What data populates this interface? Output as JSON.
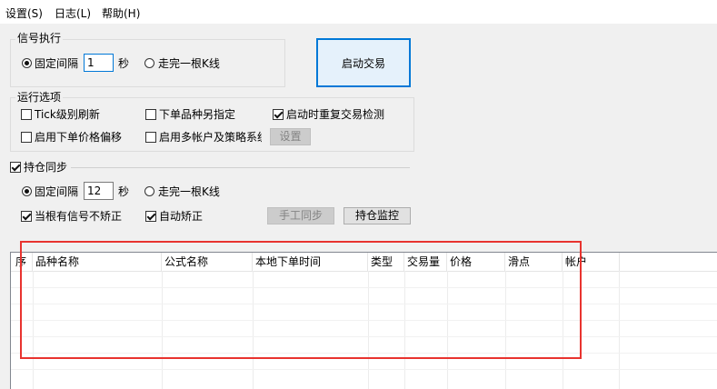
{
  "menu": {
    "items": [
      "设置(S)",
      "日志(L)",
      "帮助(H)"
    ]
  },
  "signal": {
    "title": "信号执行",
    "fixed_interval_label": "固定间隔",
    "interval_value": "1",
    "seconds_label": "秒",
    "kline_label": "走完一根K线",
    "selected": "固定间隔"
  },
  "start_button": "启动交易",
  "run_options": {
    "title": "运行选项",
    "tick_refresh": {
      "label": "Tick级别刷新",
      "checked": false
    },
    "order_variety": {
      "label": "下单品种另指定",
      "checked": false
    },
    "restart_check": {
      "label": "启动时重复交易检测",
      "checked": true
    },
    "price_offset": {
      "label": "启用下单价格偏移",
      "checked": false
    },
    "multi_account": {
      "label": "启用多帐户及策略系统",
      "checked": false
    },
    "settings_button": "设置"
  },
  "position_sync": {
    "title": "持仓同步",
    "checked": true,
    "fixed_interval_label": "固定间隔",
    "interval_value": "12",
    "seconds_label": "秒",
    "kline_label": "走完一根K线",
    "selected": "固定间隔",
    "no_correct": {
      "label": "当根有信号不矫正",
      "checked": true
    },
    "auto_correct": {
      "label": "自动矫正",
      "checked": true
    },
    "manual_sync_button": "手工同步",
    "monitor_button": "持仓监控"
  },
  "table": {
    "columns": [
      "序",
      "品种名称",
      "公式名称",
      "本地下单时间",
      "类型",
      "交易量",
      "价格",
      "滑点",
      "帐户"
    ],
    "rows": []
  },
  "colors": {
    "highlight": "#e8332f",
    "accent": "#0078d7"
  }
}
